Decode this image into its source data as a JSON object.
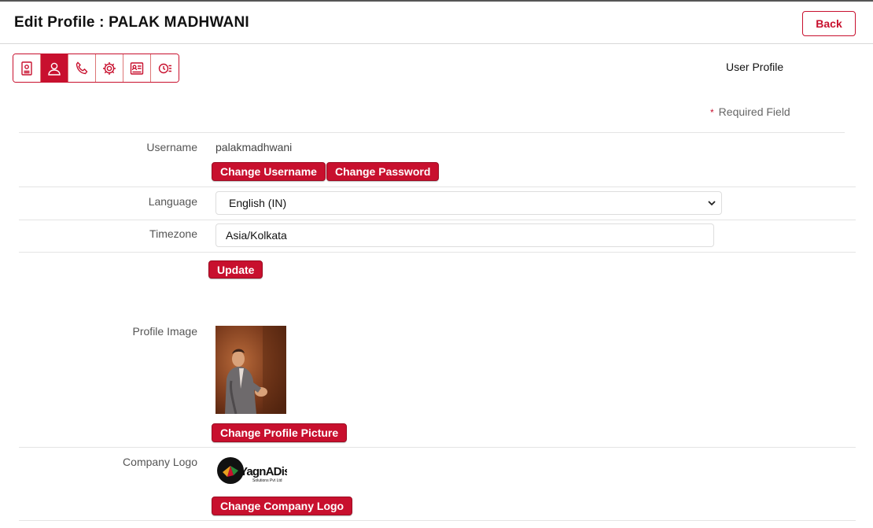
{
  "header": {
    "title": "Edit Profile : PALAK MADHWANI",
    "back_label": "Back"
  },
  "tabs": [
    {
      "icon": "id-card-icon"
    },
    {
      "icon": "user-icon",
      "active": true
    },
    {
      "icon": "phone-icon"
    },
    {
      "icon": "gear-icon"
    },
    {
      "icon": "contact-card-icon"
    },
    {
      "icon": "clock-list-icon"
    }
  ],
  "section_label": "User Profile",
  "required_note": {
    "star": "*",
    "text": "Required Field"
  },
  "form": {
    "username_label": "Username",
    "username_value": "palakmadhwani",
    "change_username_label": "Change Username",
    "change_password_label": "Change Password",
    "language_label": "Language",
    "language_value": "English (IN)",
    "timezone_label": "Timezone",
    "timezone_value": "Asia/Kolkata",
    "update_label": "Update",
    "profile_image_label": "Profile Image",
    "change_profile_picture_label": "Change Profile Picture",
    "company_logo_label": "Company Logo",
    "company_logo_text": "YagnADism",
    "company_logo_subtext": "Solutions Pvt Ltd",
    "change_company_logo_label": "Change Company Logo"
  },
  "colors": {
    "accent": "#c8102e",
    "border": "#e4e4e4"
  }
}
